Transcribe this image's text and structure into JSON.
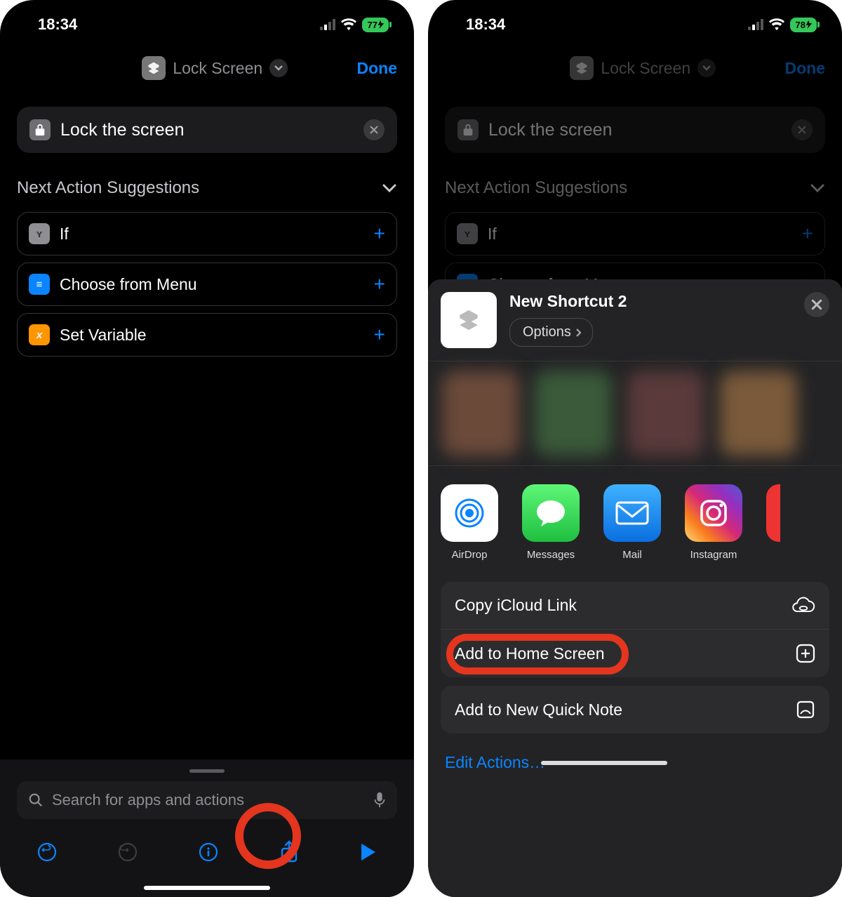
{
  "left": {
    "status": {
      "time": "18:34",
      "battery": "77"
    },
    "titlebar": {
      "title": "Lock Screen",
      "done": "Done"
    },
    "action_block": {
      "text": "Lock the screen"
    },
    "suggestions": {
      "header": "Next Action Suggestions",
      "items": [
        {
          "label": "If",
          "icon_bg": "#8e8e93",
          "icon_text": "Y"
        },
        {
          "label": "Choose from Menu",
          "icon_bg": "#0a84ff",
          "icon_text": "≡"
        },
        {
          "label": "Set Variable",
          "icon_bg": "#ff9500",
          "icon_text": "x"
        }
      ]
    },
    "search": {
      "placeholder": "Search for apps and actions"
    }
  },
  "right": {
    "status": {
      "time": "18:34",
      "battery": "78"
    },
    "titlebar": {
      "title": "Lock Screen",
      "done": "Done"
    },
    "action_block": {
      "text": "Lock the screen"
    },
    "suggestions": {
      "header": "Next Action Suggestions",
      "items": [
        {
          "label": "If",
          "icon_bg": "#8e8e93",
          "icon_text": "Y"
        },
        {
          "label": "Choose from Menu",
          "icon_bg": "#0a84ff",
          "icon_text": "≡"
        }
      ]
    },
    "share": {
      "title": "New Shortcut 2",
      "options": "Options",
      "apps": [
        {
          "label": "AirDrop",
          "bg": "#ffffff"
        },
        {
          "label": "Messages",
          "bg": "#34c759"
        },
        {
          "label": "Mail",
          "bg": "#1f8cff"
        },
        {
          "label": "Instagram",
          "bg": "linear-gradient(45deg,#feda75,#d62976,#4f5bd5)"
        }
      ],
      "actions_group1": [
        {
          "label": "Copy iCloud Link",
          "icon": "cloud-link"
        },
        {
          "label": "Add to Home Screen",
          "icon": "plus-square",
          "highlight": true
        }
      ],
      "actions_group2": [
        {
          "label": "Add to New Quick Note",
          "icon": "quicknote"
        }
      ],
      "edit": "Edit Actions…"
    }
  }
}
